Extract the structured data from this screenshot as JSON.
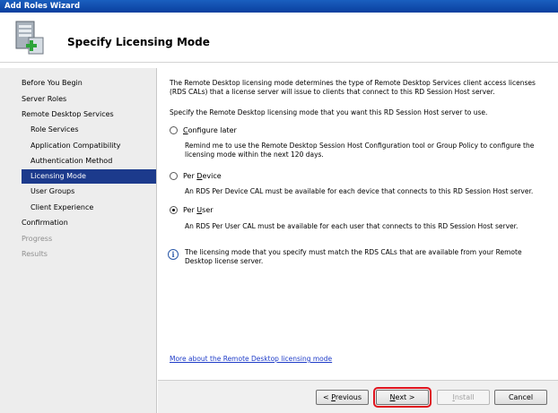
{
  "window": {
    "title": "Add Roles Wizard"
  },
  "header": {
    "title": "Specify Licensing Mode",
    "icon": "server-roles-icon"
  },
  "sidebar": {
    "items": [
      {
        "label": "Before You Begin",
        "state": "normal"
      },
      {
        "label": "Server Roles",
        "state": "normal"
      },
      {
        "label": "Remote Desktop Services",
        "state": "normal"
      },
      {
        "label": "Role Services",
        "state": "normal"
      },
      {
        "label": "Application Compatibility",
        "state": "normal"
      },
      {
        "label": "Authentication Method",
        "state": "normal"
      },
      {
        "label": "Licensing Mode",
        "state": "selected"
      },
      {
        "label": "User Groups",
        "state": "normal"
      },
      {
        "label": "Client Experience",
        "state": "normal"
      },
      {
        "label": "Confirmation",
        "state": "normal"
      },
      {
        "label": "Progress",
        "state": "disabled"
      },
      {
        "label": "Results",
        "state": "disabled"
      }
    ]
  },
  "main": {
    "intro": "The Remote Desktop licensing mode determines the type of Remote Desktop Services client access licenses (RDS CALs) that a license server will issue to clients that connect to this RD Session Host server.",
    "instruction": "Specify the Remote Desktop licensing mode that you want this RD Session Host server to use.",
    "options": [
      {
        "label_pre": "",
        "label_ul": "C",
        "label_post": "onfigure later",
        "description": "Remind me to use the Remote Desktop Session Host Configuration tool or Group Policy to configure the licensing mode within the next 120 days.",
        "checked": false
      },
      {
        "label_pre": "Per ",
        "label_ul": "D",
        "label_post": "evice",
        "description": "An RDS Per Device CAL must be available for each device that connects to this RD Session Host server.",
        "checked": false
      },
      {
        "label_pre": "Per ",
        "label_ul": "U",
        "label_post": "ser",
        "description": "An RDS Per User CAL must be available for each user that connects to this RD Session Host server.",
        "checked": true
      }
    ],
    "info_icon": "info-icon",
    "info_text": "The licensing mode that you specify must match the RDS CALs that are available from your Remote Desktop license server.",
    "help_link": "More about the Remote Desktop licensing mode"
  },
  "footer": {
    "previous": {
      "pre": "< ",
      "ul": "P",
      "post": "revious"
    },
    "next": {
      "pre": "",
      "ul": "N",
      "post": "ext >"
    },
    "install": {
      "pre": "",
      "ul": "I",
      "post": "nstall"
    },
    "cancel": "Cancel"
  },
  "colors": {
    "title_bar": "#0a3f9e",
    "selected_nav": "#1c3a8c",
    "sidebar_bg": "#ededed",
    "link": "#1f3cc8",
    "focus_highlight": "#e0141e"
  }
}
